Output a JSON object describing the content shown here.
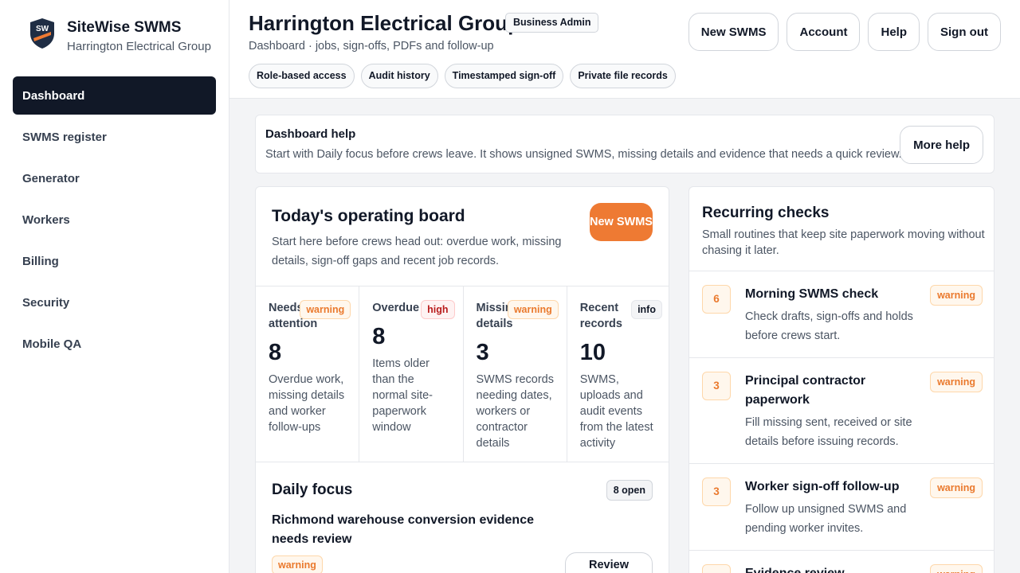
{
  "brand": {
    "name": "SiteWise SWMS",
    "org": "Harrington Electrical Group",
    "logo_text": "SW"
  },
  "nav": [
    {
      "label": "Dashboard",
      "active": true
    },
    {
      "label": "SWMS register"
    },
    {
      "label": "Generator"
    },
    {
      "label": "Workers"
    },
    {
      "label": "Billing"
    },
    {
      "label": "Security"
    },
    {
      "label": "Mobile QA"
    }
  ],
  "header": {
    "title": "Harrington Electrical Group",
    "role": "Business Admin",
    "subtitle": "Dashboard · jobs, sign-offs, PDFs and follow-up",
    "chips": [
      "Role-based access",
      "Audit history",
      "Timestamped sign-off",
      "Private file records"
    ],
    "actions": [
      "New SWMS",
      "Account",
      "Help",
      "Sign out"
    ]
  },
  "help": {
    "title": "Dashboard help",
    "text": "Start with Daily focus before crews leave. It shows unsigned SWMS, missing details and evidence that needs a quick review.",
    "button": "More help"
  },
  "board": {
    "title": "Today's operating board",
    "description": "Start here before crews head out: overdue work, missing details, sign-off gaps and recent job records.",
    "new_button": "New SWMS",
    "stats": [
      {
        "label": "Needs attention",
        "badge": "warning",
        "value": "8",
        "desc": "Overdue work, missing details and worker follow-ups"
      },
      {
        "label": "Overdue",
        "badge": "high",
        "value": "8",
        "desc": "Items older than the normal site-paperwork window"
      },
      {
        "label": "Missing details",
        "badge": "warning",
        "value": "3",
        "desc": "SWMS records needing dates, workers or contractor details"
      },
      {
        "label": "Recent records",
        "badge": "info",
        "value": "10",
        "desc": "SWMS, uploads and audit events from the latest activity"
      }
    ],
    "focus": {
      "title": "Daily focus",
      "count": "8 open",
      "item_title": "Richmond warehouse conversion evidence needs review",
      "item_badge": "warning",
      "review_button": "Review"
    }
  },
  "checks": {
    "title": "Recurring checks",
    "description": "Small routines that keep site paperwork moving without chasing it later.",
    "items": [
      {
        "count": "6",
        "title": "Morning SWMS check",
        "desc": "Check drafts, sign-offs and holds before crews start.",
        "badge": "warning"
      },
      {
        "count": "3",
        "title": "Principal contractor paperwork",
        "desc": "Fill missing sent, received or site details before issuing records.",
        "badge": "warning"
      },
      {
        "count": "3",
        "title": "Worker sign-off follow-up",
        "desc": "Follow up unsigned SWMS and pending worker invites.",
        "badge": "warning"
      },
      {
        "count": "",
        "title": "Evidence review",
        "desc": "",
        "badge": "warning"
      }
    ]
  },
  "colors": {
    "accent": "#ee7a33",
    "nav_active": "#111827",
    "warning": "#ea7a2e",
    "high": "#b91c1c"
  }
}
